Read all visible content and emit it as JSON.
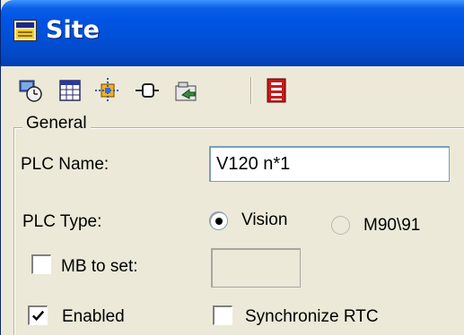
{
  "window": {
    "title": "Site",
    "colors": {
      "titlebar": "#0054e3",
      "face": "#ece9d8"
    }
  },
  "toolbar": {
    "buttons": [
      {
        "icon": "clock-settings-icon"
      },
      {
        "icon": "grid-icon"
      },
      {
        "icon": "network-icon"
      },
      {
        "icon": "connector-icon"
      },
      {
        "icon": "folder-arrow-icon"
      },
      {
        "icon": "ladder-icon"
      }
    ]
  },
  "general": {
    "title": "General",
    "plc_name_label": "PLC Name:",
    "plc_name_value": "V120 n*1",
    "plc_type_label": "PLC Type:",
    "plc_type_options": [
      {
        "label": "Vision",
        "selected": true
      },
      {
        "label": "M90\\91",
        "selected": false
      }
    ],
    "mb_to_set_label": "MB to set:",
    "mb_to_set_checked": false,
    "mb_to_set_value": "",
    "enabled_label": "Enabled",
    "enabled_checked": true,
    "sync_rtc_label": "Synchronize RTC",
    "sync_rtc_checked": false
  }
}
